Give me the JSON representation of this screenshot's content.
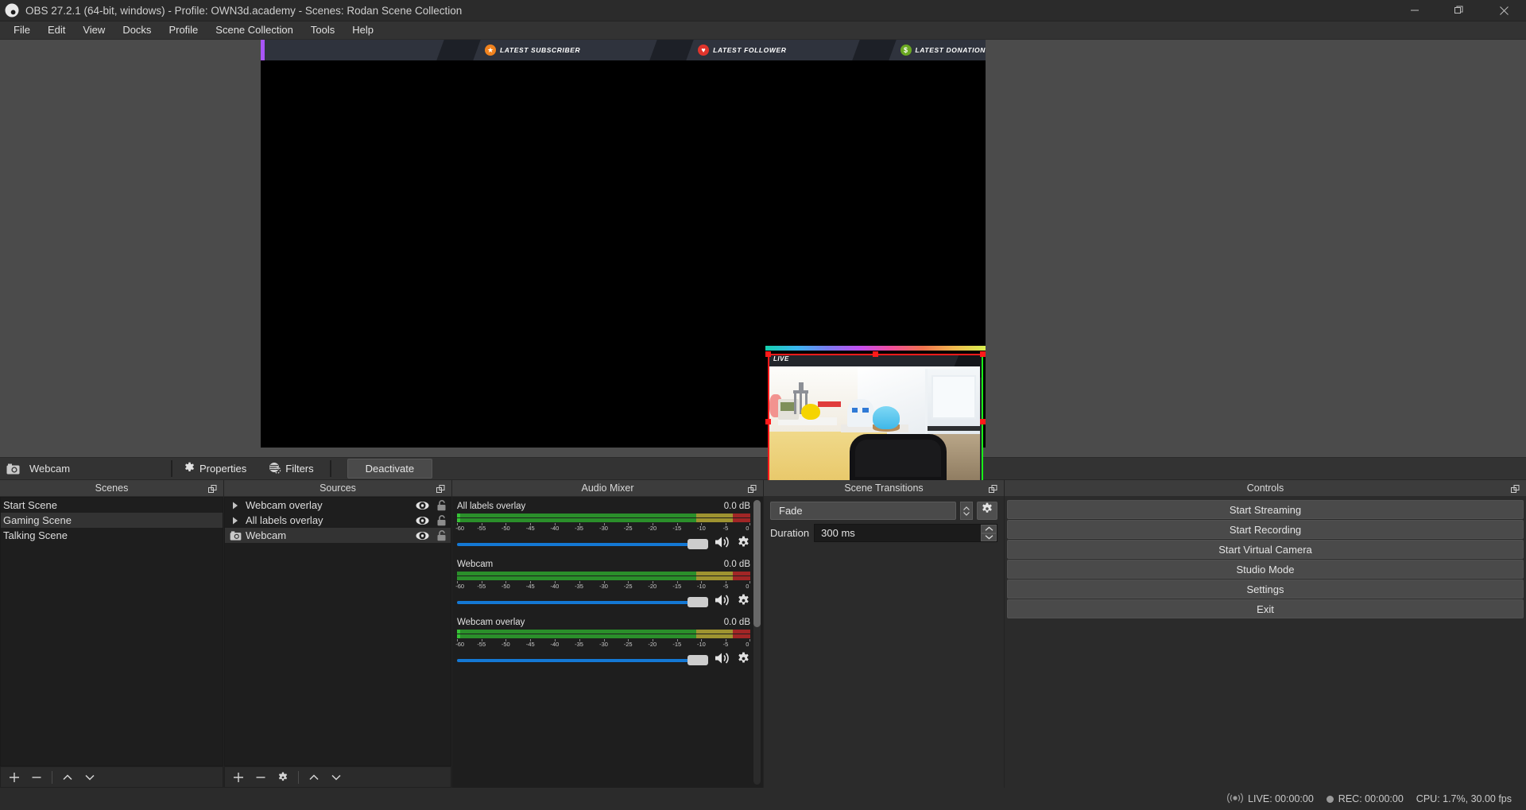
{
  "titlebar": {
    "title": "OBS 27.2.1 (64-bit, windows) - Profile: OWN3d.academy - Scenes: Rodan Scene Collection",
    "logo_icon": "obs-logo-icon",
    "minimize_icon": "minimize-icon",
    "maximize_icon": "maximize-icon",
    "close_icon": "close-icon"
  },
  "menubar": {
    "items": [
      {
        "label": "File"
      },
      {
        "label": "Edit"
      },
      {
        "label": "View"
      },
      {
        "label": "Docks"
      },
      {
        "label": "Profile"
      },
      {
        "label": "Scene Collection"
      },
      {
        "label": "Tools"
      },
      {
        "label": "Help"
      }
    ]
  },
  "preview": {
    "overlay_bar": {
      "segments": [
        {
          "label": "LATEST SUBSCRIBER",
          "icon": "star-badge-icon",
          "icon_color": "#f0821e",
          "glyph": "★"
        },
        {
          "label": "LATEST FOLLOWER",
          "icon": "heart-badge-icon",
          "icon_color": "#e0342c",
          "glyph": "♥"
        },
        {
          "label": "LATEST DONATION",
          "icon": "money-badge-icon",
          "icon_color": "#6aa821",
          "glyph": "$"
        }
      ],
      "accent_color": "#a855f7"
    },
    "webcam_source": {
      "live_label": "LIVE",
      "selected": true,
      "border_color": "#ff1a1a"
    }
  },
  "source_toolbar": {
    "source_icon": "camera-icon",
    "source_name": "Webcam",
    "properties_label": "Properties",
    "properties_icon": "gear-icon",
    "filters_label": "Filters",
    "filters_icon": "filters-icon",
    "deactivate_label": "Deactivate"
  },
  "scenes_dock": {
    "title": "Scenes",
    "float_icon": "undock-icon",
    "items": [
      {
        "label": "Start Scene",
        "selected": false
      },
      {
        "label": "Gaming Scene",
        "selected": true
      },
      {
        "label": "Talking Scene",
        "selected": false
      }
    ],
    "toolbar": [
      {
        "name": "add-scene-button",
        "icon": "plus-icon",
        "glyph": "+"
      },
      {
        "name": "remove-scene-button",
        "icon": "minus-icon",
        "glyph": "−"
      },
      {
        "name": "move-scene-up-button",
        "icon": "chevron-up-icon",
        "glyph": "∧"
      },
      {
        "name": "move-scene-down-button",
        "icon": "chevron-down-icon",
        "glyph": "∨"
      }
    ]
  },
  "sources_dock": {
    "title": "Sources",
    "float_icon": "undock-icon",
    "items": [
      {
        "label": "Webcam overlay",
        "icon": "group-expand-icon",
        "visible": true,
        "locked": false,
        "selected": false
      },
      {
        "label": "All labels overlay",
        "icon": "group-expand-icon",
        "visible": true,
        "locked": false,
        "selected": false
      },
      {
        "label": "Webcam",
        "icon": "camera-icon",
        "visible": true,
        "locked": false,
        "selected": true
      }
    ],
    "toolbar": [
      {
        "name": "add-source-button",
        "icon": "plus-icon",
        "glyph": "+"
      },
      {
        "name": "remove-source-button",
        "icon": "minus-icon",
        "glyph": "−"
      },
      {
        "name": "source-properties-button",
        "icon": "gear-icon",
        "glyph": ""
      },
      {
        "name": "move-source-up-button",
        "icon": "chevron-up-icon",
        "glyph": "∧"
      },
      {
        "name": "move-source-down-button",
        "icon": "chevron-down-icon",
        "glyph": "∨"
      }
    ]
  },
  "audio_mixer": {
    "title": "Audio Mixer",
    "float_icon": "undock-icon",
    "tick_labels": [
      "-60",
      "-55",
      "-50",
      "-45",
      "-40",
      "-35",
      "-30",
      "-25",
      "-20",
      "-15",
      "-10",
      "-5",
      "0"
    ],
    "tracks": [
      {
        "name": "All labels overlay",
        "db": "0.0 dB",
        "volume_percent": 100,
        "mute_icon": "speaker-icon",
        "gear_icon": "gear-icon"
      },
      {
        "name": "Webcam",
        "db": "0.0 dB",
        "volume_percent": 100,
        "mute_icon": "speaker-icon",
        "gear_icon": "gear-icon"
      },
      {
        "name": "Webcam overlay",
        "db": "0.0 dB",
        "volume_percent": 100,
        "mute_icon": "speaker-icon",
        "gear_icon": "gear-icon"
      }
    ]
  },
  "scene_transitions": {
    "title": "Scene Transitions",
    "float_icon": "undock-icon",
    "transition_value": "Fade",
    "transition_config_icon": "gear-icon",
    "duration_label": "Duration",
    "duration_value": "300 ms"
  },
  "controls": {
    "title": "Controls",
    "float_icon": "undock-icon",
    "buttons": [
      {
        "label": "Start Streaming"
      },
      {
        "label": "Start Recording"
      },
      {
        "label": "Start Virtual Camera"
      },
      {
        "label": "Studio Mode"
      },
      {
        "label": "Settings"
      },
      {
        "label": "Exit"
      }
    ]
  },
  "statusbar": {
    "live_icon": "broadcast-icon",
    "live_text": "LIVE: 00:00:00",
    "rec_icon": "record-dot-icon",
    "rec_text": "REC: 00:00:00",
    "cpu_text": "CPU: 1.7%, 30.00 fps"
  }
}
